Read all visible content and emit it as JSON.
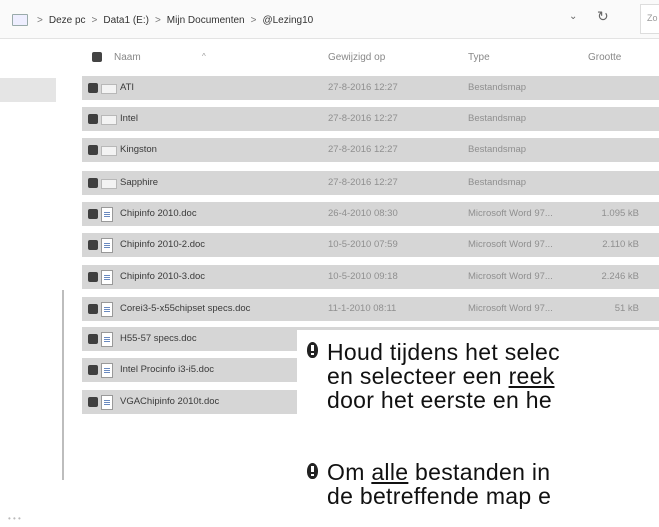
{
  "address_bar": {
    "breadcrumbs": [
      "Deze pc",
      "Data1 (E:)",
      "Mijn Documenten",
      "@Lezing10"
    ],
    "search_placeholder": "Zo"
  },
  "columns": {
    "name": "Naam",
    "date": "Gewijzigd op",
    "type": "Type",
    "size": "Grootte"
  },
  "files": [
    {
      "name": "ATI",
      "date": "27-8-2016 12:27",
      "type": "Bestandsmap",
      "size": "",
      "kind": "folder"
    },
    {
      "name": "Intel",
      "date": "27-8-2016 12:27",
      "type": "Bestandsmap",
      "size": "",
      "kind": "folder"
    },
    {
      "name": "Kingston",
      "date": "27-8-2016 12:27",
      "type": "Bestandsmap",
      "size": "",
      "kind": "folder"
    },
    {
      "name": "Sapphire",
      "date": "27-8-2016 12:27",
      "type": "Bestandsmap",
      "size": "",
      "kind": "folder"
    },
    {
      "name": "Chipinfo 2010.doc",
      "date": "26-4-2010 08:30",
      "type": "Microsoft Word 97...",
      "size": "1.095 kB",
      "kind": "doc"
    },
    {
      "name": "Chipinfo 2010-2.doc",
      "date": "10-5-2010 07:59",
      "type": "Microsoft Word 97...",
      "size": "2.110 kB",
      "kind": "doc"
    },
    {
      "name": "Chipinfo 2010-3.doc",
      "date": "10-5-2010 09:18",
      "type": "Microsoft Word 97...",
      "size": "2.246 kB",
      "kind": "doc"
    },
    {
      "name": "Corei3-5-x55chipset specs.doc",
      "date": "11-1-2010 08:11",
      "type": "Microsoft Word 97...",
      "size": "51 kB",
      "kind": "doc"
    },
    {
      "name": "H55-57 specs.doc",
      "date": "",
      "type": "",
      "size": "",
      "kind": "doc"
    },
    {
      "name": "Intel Procinfo i3-i5.doc",
      "date": "",
      "type": "",
      "size": "",
      "kind": "doc"
    },
    {
      "name": "VGAChipinfo 2010t.doc",
      "date": "",
      "type": "",
      "size": "",
      "kind": "doc"
    }
  ],
  "overlay": {
    "p1_line1": "Houd tijdens het selec",
    "p1_line2_pre": "en selecteer een ",
    "p1_line2_u": "reek",
    "p1_line3": "door het eerste en he",
    "p2_line1_pre": "Om ",
    "p2_line1_u": "alle",
    "p2_line1_post": " bestanden in",
    "p2_line2": "de betreffende map e"
  }
}
